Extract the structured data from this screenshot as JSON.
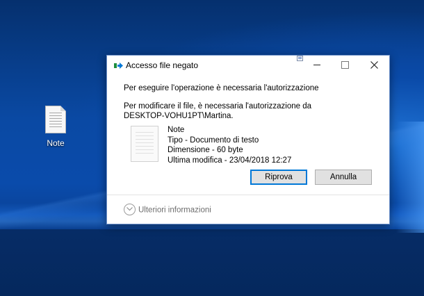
{
  "desktop": {
    "icon_label": "Note"
  },
  "dialog": {
    "title": "Accesso file negato",
    "message1": "Per eseguire l'operazione è necessaria l'autorizzazione",
    "message2_line1": "Per modificare il file, è necessaria l'autorizzazione da",
    "message2_line2": "DESKTOP-VOHU1PT\\Martina.",
    "file": {
      "name": "Note",
      "type": "Tipo - Documento di testo",
      "size": "Dimensione - 60 byte",
      "modified": "Ultima modifica - 23/04/2018 12:27"
    },
    "retry_label": "Riprova",
    "cancel_label": "Annulla",
    "more_info_label": "Ulteriori informazioni"
  },
  "colors": {
    "accent": "#0078d7",
    "desktop_blue": "#0a49a3"
  },
  "icons": [
    "text-file-icon",
    "shield-arrow-icon",
    "minimize-icon",
    "maximize-icon",
    "close-icon",
    "chevron-down-icon"
  ]
}
